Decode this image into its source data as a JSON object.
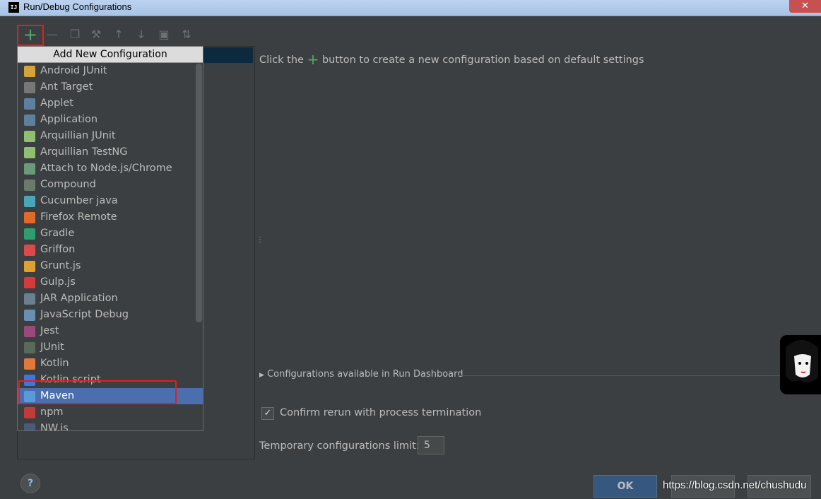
{
  "window": {
    "app_icon": "IJ",
    "title": "Run/Debug Configurations",
    "close": "✕"
  },
  "toolbar": {
    "add": "+",
    "remove": "—",
    "copy": "❐",
    "edit": "⚒",
    "up": "↑",
    "down": "↓",
    "folder": "▣",
    "sort": "⇅"
  },
  "popup": {
    "header": "Add New Configuration",
    "items": [
      {
        "label": "Android JUnit",
        "icon": "android-junit-icon",
        "color": "#d6a23c"
      },
      {
        "label": "Ant Target",
        "icon": "ant-icon",
        "color": "#777777"
      },
      {
        "label": "Applet",
        "icon": "applet-icon",
        "color": "#5f7f9f"
      },
      {
        "label": "Application",
        "icon": "application-icon",
        "color": "#5f7f9f"
      },
      {
        "label": "Arquillian JUnit",
        "icon": "arquillian-icon",
        "color": "#8fbf6f"
      },
      {
        "label": "Arquillian TestNG",
        "icon": "arquillian-icon",
        "color": "#8fbf6f"
      },
      {
        "label": "Attach to Node.js/Chrome",
        "icon": "node-attach-icon",
        "color": "#6a9a7a"
      },
      {
        "label": "Compound",
        "icon": "compound-icon",
        "color": "#6b7b6b"
      },
      {
        "label": "Cucumber java",
        "icon": "cucumber-icon",
        "color": "#4aa6b6"
      },
      {
        "label": "Firefox Remote",
        "icon": "firefox-icon",
        "color": "#e06a2a"
      },
      {
        "label": "Gradle",
        "icon": "gradle-icon",
        "color": "#2e9e6e"
      },
      {
        "label": "Griffon",
        "icon": "griffon-icon",
        "color": "#d94a4a"
      },
      {
        "label": "Grunt.js",
        "icon": "grunt-icon",
        "color": "#e0a030"
      },
      {
        "label": "Gulp.js",
        "icon": "gulp-icon",
        "color": "#d83a3a"
      },
      {
        "label": "JAR Application",
        "icon": "jar-icon",
        "color": "#6a7f8f"
      },
      {
        "label": "JavaScript Debug",
        "icon": "js-debug-icon",
        "color": "#6a8faf"
      },
      {
        "label": "Jest",
        "icon": "jest-icon",
        "color": "#9a4a7a"
      },
      {
        "label": "JUnit",
        "icon": "junit-icon",
        "color": "#5a6a5a"
      },
      {
        "label": "Kotlin",
        "icon": "kotlin-icon",
        "color": "#e0783a"
      },
      {
        "label": "Kotlin script",
        "icon": "kotlin-script-icon",
        "color": "#3a78e0"
      },
      {
        "label": "Maven",
        "icon": "maven-gear-icon",
        "color": "#5a9ad8"
      },
      {
        "label": "npm",
        "icon": "npm-icon",
        "color": "#c33a3a"
      },
      {
        "label": "NW.js",
        "icon": "nwjs-icon",
        "color": "#4a5a7a"
      }
    ]
  },
  "hint": {
    "prefix": "Click the",
    "plus": "+",
    "suffix": "button to create a new configuration based on default settings"
  },
  "dashboard": {
    "label": "Configurations available in Run Dashboard"
  },
  "confirm_rerun": {
    "label": "Confirm rerun with process termination",
    "checked": true,
    "mark": "✓"
  },
  "temp_limit": {
    "label": "Temporary configurations limit:",
    "value": "5"
  },
  "buttons": {
    "help": "?",
    "ok": "OK"
  },
  "watermark": "https://blog.csdn.net/chushudu"
}
